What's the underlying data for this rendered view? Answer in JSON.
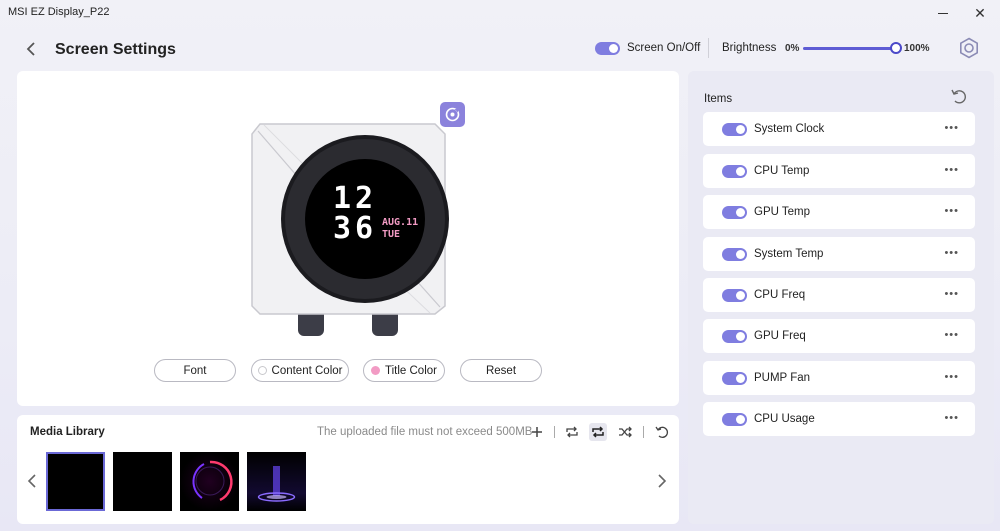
{
  "window": {
    "title": "MSI EZ Display_P22"
  },
  "header": {
    "title": "Screen Settings",
    "screen_toggle_label": "Screen On/Off",
    "screen_on": true,
    "brightness_label": "Brightness",
    "brightness_min": "0%",
    "brightness_max": "100%",
    "brightness_value": 1.0
  },
  "preview": {
    "display_hour": "12",
    "display_minute": "36",
    "display_date": "AUG.11",
    "display_day": "TUE",
    "buttons": {
      "font": "Font",
      "content_color": "Content Color",
      "title_color": "Title Color",
      "reset": "Reset"
    },
    "colors": {
      "content_color": "#ffffff",
      "title_color": "#f29bc4",
      "accent": "#7f7de0"
    }
  },
  "media": {
    "title": "Media Library",
    "note": "The uploaded file must not exceed 500MB",
    "selected_index": 0
  },
  "items": {
    "title": "Items",
    "list": [
      {
        "label": "System Clock",
        "enabled": true
      },
      {
        "label": "CPU Temp",
        "enabled": true
      },
      {
        "label": "GPU Temp",
        "enabled": true
      },
      {
        "label": "System Temp",
        "enabled": true
      },
      {
        "label": "CPU Freq",
        "enabled": true
      },
      {
        "label": "GPU Freq",
        "enabled": true
      },
      {
        "label": "PUMP Fan",
        "enabled": true
      },
      {
        "label": "CPU Usage",
        "enabled": true
      }
    ]
  },
  "icons": {
    "back": "chevron-left-icon",
    "settings": "gear-icon",
    "add": "plus-icon",
    "loop-all": "repeat-icon",
    "loop": "repeat-active-icon",
    "shuffle": "shuffle-icon",
    "reset": "undo-icon",
    "more": "ellipsis-icon",
    "customize": "palette-icon"
  }
}
